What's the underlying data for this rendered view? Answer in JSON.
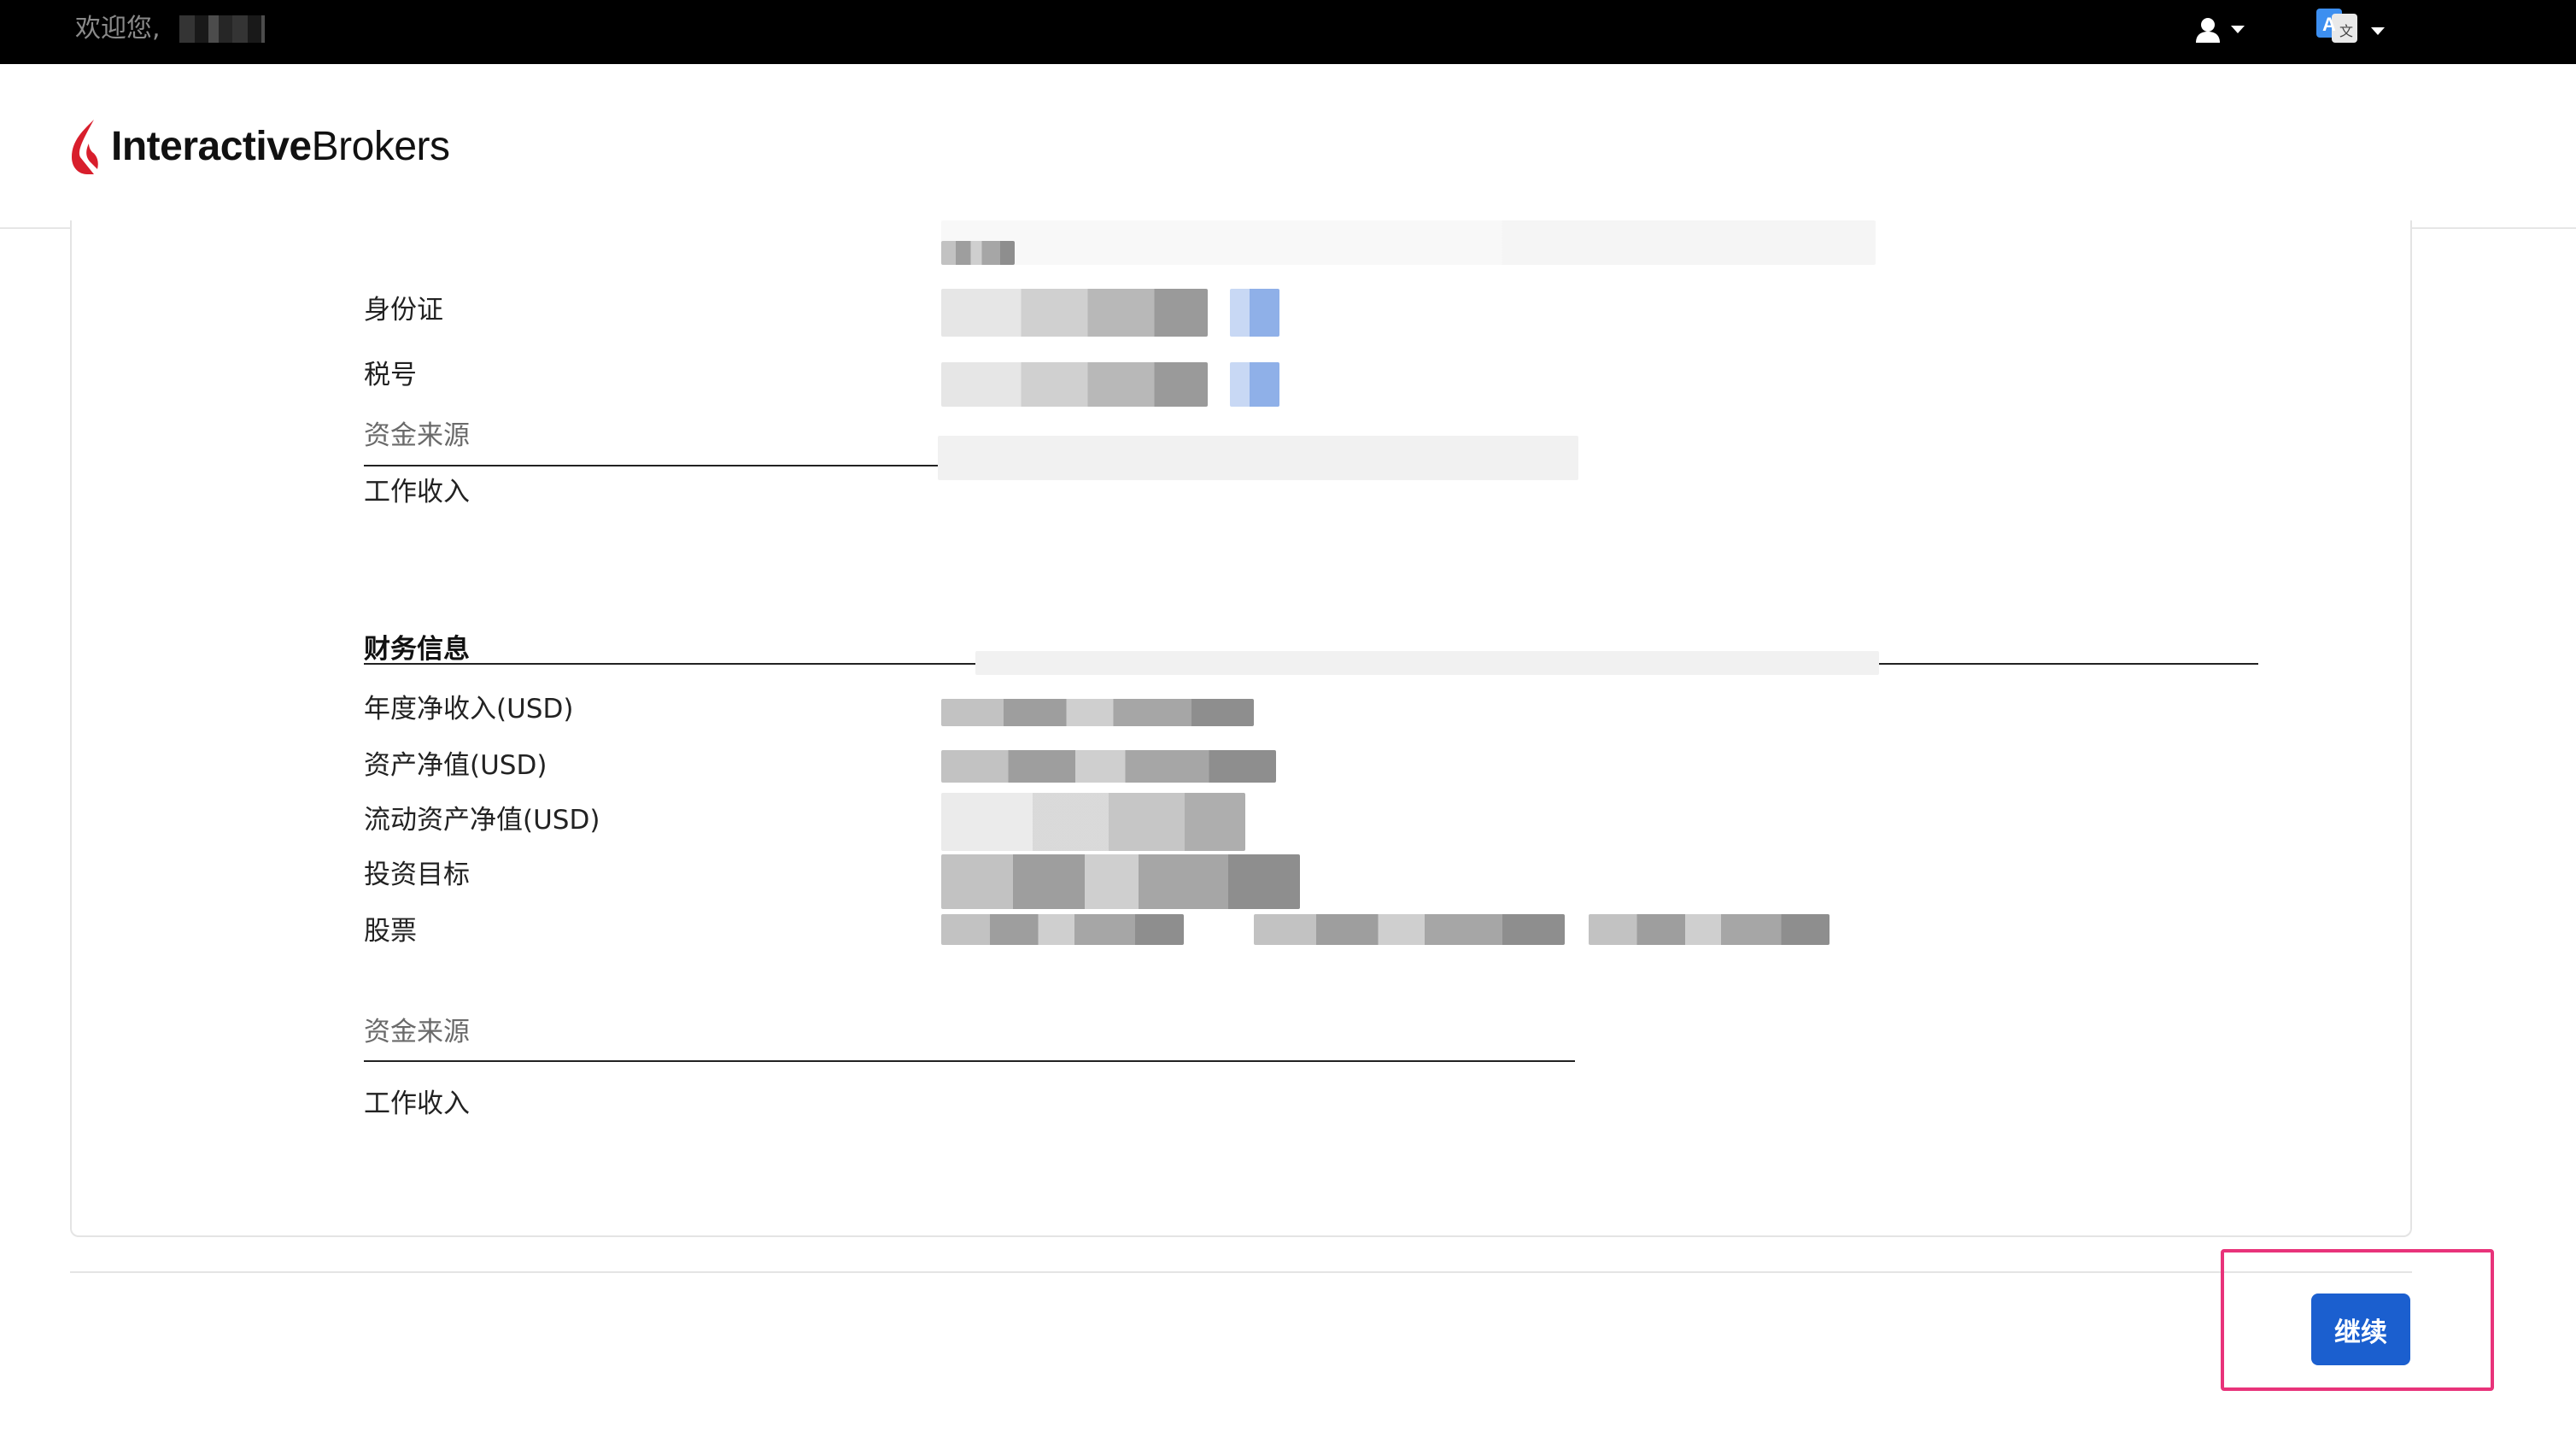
{
  "topbar": {
    "welcome": "欢迎您,",
    "user_icon": "user-icon",
    "language_icon": "translate-icon"
  },
  "brand": {
    "name_bold": "Interactive",
    "name_regular": "Brokers",
    "accent_color": "#d81e2c"
  },
  "identity": {
    "id_card_label": "身份证",
    "tax_number_label": "税号",
    "source_of_funds_header": "资金来源",
    "source_of_funds_value": "工作收入"
  },
  "financial": {
    "section_title": "财务信息",
    "annual_net_income_label": "年度净收入(USD)",
    "net_worth_label": "资产净值(USD)",
    "liquid_net_worth_label": "流动资产净值(USD)",
    "investment_objective_label": "投资目标",
    "stocks_label": "股票",
    "source_of_funds_header": "资金来源",
    "source_of_funds_value": "工作收入"
  },
  "actions": {
    "continue_label": "继续",
    "continue_color": "#1b5fcf",
    "highlight_color": "#e8337a"
  }
}
